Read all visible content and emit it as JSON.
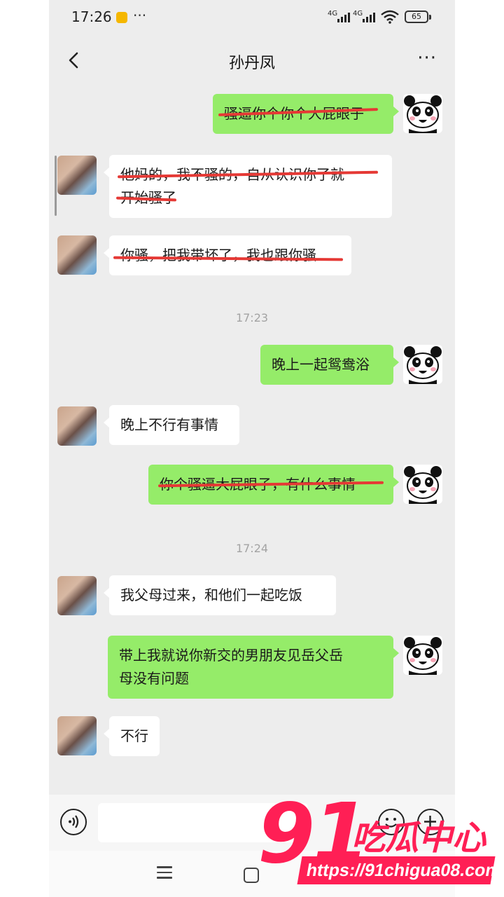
{
  "status_bar": {
    "time": "17:26",
    "more": "···",
    "signal_1": "4G",
    "signal_2": "4G",
    "battery": "65"
  },
  "header": {
    "title": "孙丹凤",
    "more": "···"
  },
  "messages": [
    {
      "side": "out",
      "text": "骚逼你个你个大屁眼子",
      "struck": true
    },
    {
      "side": "in",
      "text": "他妈的，我不骚的，自从认识你了就\n开始骚了",
      "struck": true
    },
    {
      "side": "in",
      "text": "你骚，把我带坏了，我也跟你骚",
      "struck": true
    },
    {
      "side": "out",
      "text": "晚上一起鸳鸯浴",
      "struck": false
    },
    {
      "side": "in",
      "text": "晚上不行有事情",
      "struck": false
    },
    {
      "side": "out",
      "text": "你个骚逼大屁眼子，有什么事情",
      "struck": true
    },
    {
      "side": "in",
      "text": "我父母过来，和他们一起吃饭",
      "struck": false
    },
    {
      "side": "out",
      "text": "带上我就说你新交的男朋友见岳父岳\n母没有问题",
      "struck": false
    },
    {
      "side": "in",
      "text": "不行",
      "struck": false
    }
  ],
  "timestamps": [
    "17:23",
    "17:24"
  ],
  "colors": {
    "chat_background": "#ededed",
    "outgoing_bubble": "#95ec69",
    "incoming_bubble": "#ffffff",
    "strike_line": "#e53935",
    "watermark": "#ff1f55"
  },
  "icons": {
    "back": "chevron-left-icon",
    "voice": "voice-icon",
    "emoji": "emoji-icon",
    "plus": "plus-icon",
    "menu": "menu-icon",
    "home": "home-icon"
  },
  "watermark": {
    "number": "91",
    "name": "吃瓜中心",
    "url": "https://91chigua08.com"
  }
}
